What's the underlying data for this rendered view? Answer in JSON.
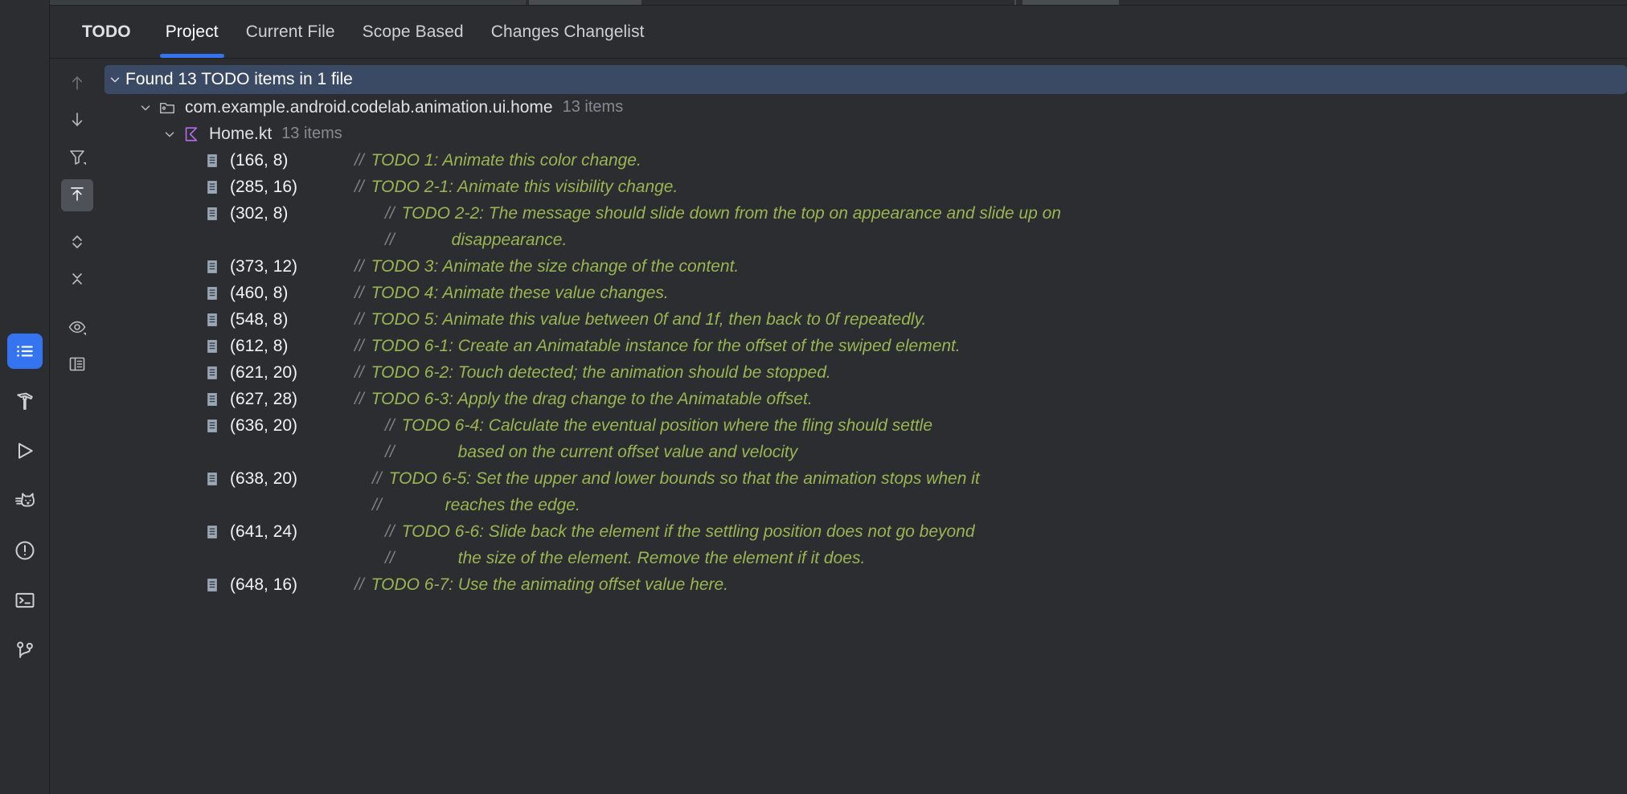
{
  "window": {
    "background": "#2b2d30",
    "accent": "#3574f0",
    "todo_text_color": "#9ab552",
    "comment_slash_color": "#7f8186",
    "header_selected_background": "#3b4a64"
  },
  "activity_bar": {
    "items": [
      {
        "name": "todo-tool-window",
        "icon": "list-icon",
        "active": true,
        "tooltip": "TODO"
      },
      {
        "name": "build-tool-window",
        "icon": "hammer-icon",
        "active": false,
        "tooltip": "Build"
      },
      {
        "name": "run-tool-window",
        "icon": "play-icon",
        "active": false,
        "tooltip": "Run"
      },
      {
        "name": "logcat-tool-window",
        "icon": "cat-icon",
        "active": false,
        "tooltip": "Logcat"
      },
      {
        "name": "problems-tool-window",
        "icon": "exclamation-circle-icon",
        "active": false,
        "tooltip": "Problems"
      },
      {
        "name": "terminal-tool-window",
        "icon": "terminal-icon",
        "active": false,
        "tooltip": "Terminal"
      },
      {
        "name": "version-control-tool-window",
        "icon": "git-branch-icon",
        "active": false,
        "tooltip": "Version Control"
      }
    ]
  },
  "tabs": {
    "title": "TODO",
    "items": [
      {
        "label": "Project",
        "selected": true
      },
      {
        "label": "Current File",
        "selected": false
      },
      {
        "label": "Scope Based",
        "selected": false
      },
      {
        "label": "Changes Changelist",
        "selected": false
      }
    ]
  },
  "toolbar": {
    "buttons": [
      {
        "name": "previous-occurrence-button",
        "icon": "arrow-up-icon",
        "state": "disabled"
      },
      {
        "name": "next-occurrence-button",
        "icon": "arrow-down-icon",
        "state": "enabled"
      },
      {
        "name": "filter-button",
        "icon": "filter-icon",
        "state": "enabled"
      },
      {
        "name": "autoscroll-to-source-button",
        "icon": "autoscroll-icon",
        "state": "toggled"
      },
      {
        "name": "expand-all-button",
        "icon": "expand-all-icon",
        "state": "enabled"
      },
      {
        "name": "collapse-all-button",
        "icon": "collapse-all-icon",
        "state": "enabled"
      },
      {
        "name": "preview-source-button",
        "icon": "eye-icon",
        "state": "enabled"
      },
      {
        "name": "group-by-button",
        "icon": "group-by-icon",
        "state": "enabled"
      }
    ]
  },
  "tree": {
    "summary": {
      "label": "Found 13 TODO items in 1 file",
      "expanded": true,
      "selected": true
    },
    "package": {
      "label": "com.example.android.codelab.animation.ui.home",
      "count": "13 items",
      "icon": "package-icon",
      "expanded": true
    },
    "file": {
      "label": "Home.kt",
      "count": "13 items",
      "icon": "kotlin-file-icon",
      "expanded": true
    },
    "items": [
      {
        "position": "(166, 8)",
        "pos_width": 145,
        "prefix_gap": 0,
        "comment_marker": "//",
        "text": "TODO 1: Animate this color change.",
        "continuations": []
      },
      {
        "position": "(285, 16)",
        "pos_width": 145,
        "prefix_gap": 0,
        "comment_marker": "//",
        "text": "TODO 2-1: Animate this visibility change.",
        "continuations": []
      },
      {
        "position": "(302, 8)",
        "pos_width": 145,
        "prefix_gap": 38,
        "comment_marker": "//",
        "text": "TODO 2-2: The message should slide down from the top on appearance and slide up on",
        "continuations": [
          {
            "comment_marker": "//",
            "indent": 62,
            "text": "disappearance."
          }
        ]
      },
      {
        "position": "(373, 12)",
        "pos_width": 145,
        "prefix_gap": 0,
        "comment_marker": "//",
        "text": "TODO 3: Animate the size change of the content.",
        "continuations": []
      },
      {
        "position": "(460, 8)",
        "pos_width": 145,
        "prefix_gap": 0,
        "comment_marker": "//",
        "text": "TODO 4: Animate these value changes.",
        "continuations": []
      },
      {
        "position": "(548, 8)",
        "pos_width": 145,
        "prefix_gap": 0,
        "comment_marker": "//",
        "text": "TODO 5: Animate this value between 0f and 1f, then back to 0f repeatedly.",
        "continuations": []
      },
      {
        "position": "(612, 8)",
        "pos_width": 145,
        "prefix_gap": 0,
        "comment_marker": "//",
        "text": "TODO 6-1: Create an Animatable instance for the offset of the swiped element.",
        "continuations": []
      },
      {
        "position": "(621, 20)",
        "pos_width": 145,
        "prefix_gap": 0,
        "comment_marker": "//",
        "text": "TODO 6-2: Touch detected; the animation should be stopped.",
        "continuations": []
      },
      {
        "position": "(627, 28)",
        "pos_width": 145,
        "prefix_gap": 0,
        "comment_marker": "//",
        "text": "TODO 6-3: Apply the drag change to the Animatable offset.",
        "continuations": []
      },
      {
        "position": "(636, 20)",
        "pos_width": 145,
        "prefix_gap": 38,
        "comment_marker": "//",
        "text": "TODO 6-4: Calculate the eventual position where the fling should settle",
        "continuations": [
          {
            "comment_marker": "//",
            "indent": 70,
            "text": "based on the current offset value and velocity"
          }
        ]
      },
      {
        "position": "(638, 20)",
        "pos_width": 145,
        "prefix_gap": 22,
        "comment_marker": "//",
        "text": "TODO 6-5: Set the upper and lower bounds so that the animation stops when it",
        "continuations": [
          {
            "comment_marker": "//",
            "indent": 70,
            "text": "reaches the edge."
          }
        ]
      },
      {
        "position": "(641, 24)",
        "pos_width": 145,
        "prefix_gap": 38,
        "comment_marker": "//",
        "text": "TODO 6-6: Slide back the element if the settling position does not go beyond",
        "continuations": [
          {
            "comment_marker": "//",
            "indent": 70,
            "text": "the size of the element. Remove the element if it does."
          }
        ]
      },
      {
        "position": "(648, 16)",
        "pos_width": 145,
        "prefix_gap": 0,
        "comment_marker": "//",
        "text": "TODO 6-7: Use the animating offset value here.",
        "continuations": []
      }
    ]
  }
}
